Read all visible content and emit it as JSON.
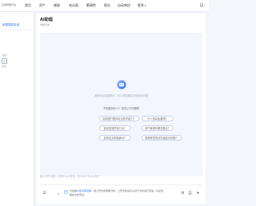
{
  "header": {
    "logo_text": "云顶智能平台",
    "nav": [
      "首页",
      "资产",
      "威胁",
      "攻击面",
      "脆弱性",
      "报告",
      "自动响应",
      "更多"
    ],
    "more_caret": "▾"
  },
  "sidebar": {
    "active_link": "新建智能会话",
    "section_label": "最近",
    "add_icon": "+",
    "empty_label": "暂无"
  },
  "main": {
    "title": "AI助理",
    "subtitle": "智能问答",
    "greeting": "我是安全智能助手，可以帮您解答安全相关问题",
    "hint": "不知道问什么？试试以下问题吧",
    "suggestions": [
      "如何提升整体安全防护能力？",
      "什么是高危漏洞？",
      "如何发现异常行为？",
      "资产管理有哪些要点？",
      "如何应对勒索病毒？",
      "漏洞修复的优先级如何判断？"
    ],
    "input_placeholder": "输入你的问题，可按Enter发送，按Shift+Enter换行",
    "doc_icon": "☰",
    "doc_caret": "▾",
    "note_prefix": "可选择",
    "note_link": "从知识库选择",
    "note_suffix": "，或上传文件帮助分析，上传文件后可以基于文件进行问答。请注意保护文件安全。",
    "action_icons": [
      "⚙",
      "⎙",
      "➤"
    ]
  },
  "colors": {
    "accent": "#3a6cf6",
    "panel_bg": "#f3f6fc",
    "page_bg": "#f4f6fb"
  }
}
